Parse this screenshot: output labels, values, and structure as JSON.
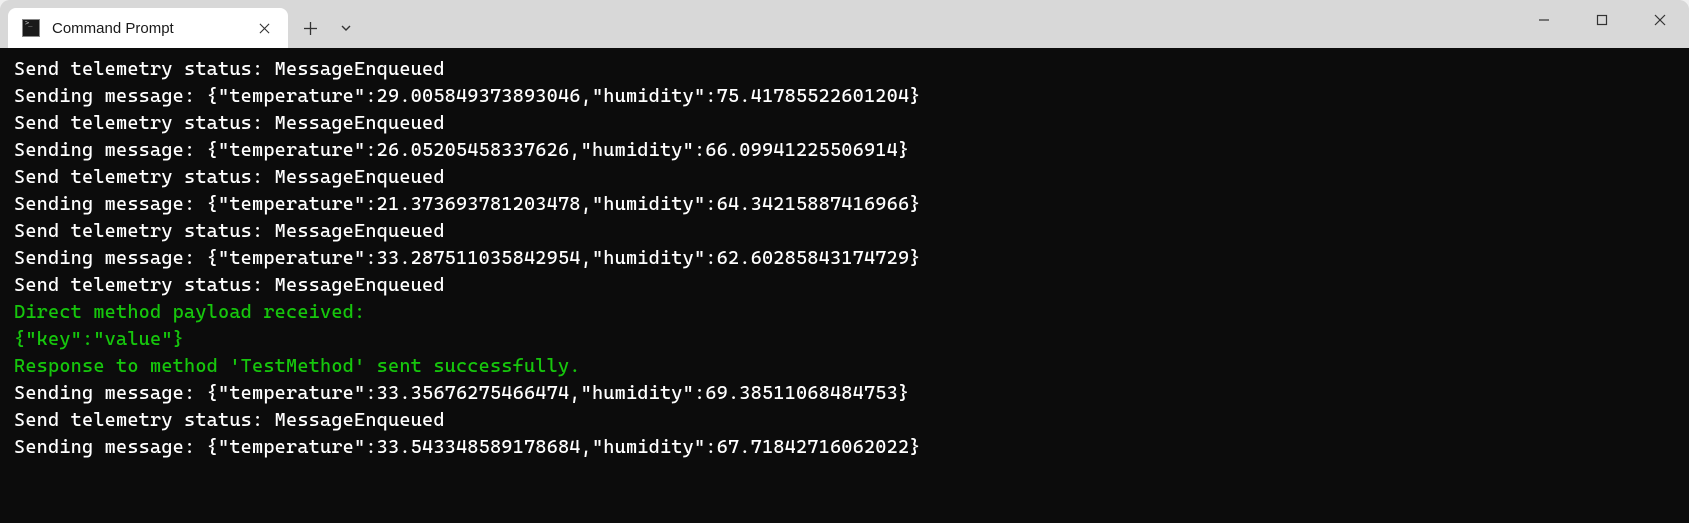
{
  "tab": {
    "title": "Command Prompt"
  },
  "terminal": {
    "lines": [
      {
        "text": "Send telemetry status: MessageEnqueued",
        "color": "white"
      },
      {
        "text": "Sending message: {\"temperature\":29.005849373893046,\"humidity\":75.41785522601204}",
        "color": "white"
      },
      {
        "text": "Send telemetry status: MessageEnqueued",
        "color": "white"
      },
      {
        "text": "Sending message: {\"temperature\":26.05205458337626,\"humidity\":66.09941225506914}",
        "color": "white"
      },
      {
        "text": "Send telemetry status: MessageEnqueued",
        "color": "white"
      },
      {
        "text": "Sending message: {\"temperature\":21.373693781203478,\"humidity\":64.34215887416966}",
        "color": "white"
      },
      {
        "text": "Send telemetry status: MessageEnqueued",
        "color": "white"
      },
      {
        "text": "Sending message: {\"temperature\":33.287511035842954,\"humidity\":62.60285843174729}",
        "color": "white"
      },
      {
        "text": "Send telemetry status: MessageEnqueued",
        "color": "white"
      },
      {
        "text": "Direct method payload received:",
        "color": "green"
      },
      {
        "text": "{\"key\":\"value\"}",
        "color": "green"
      },
      {
        "text": "Response to method 'TestMethod' sent successfully.",
        "color": "green"
      },
      {
        "text": "Sending message: {\"temperature\":33.35676275466474,\"humidity\":69.38511068484753}",
        "color": "white"
      },
      {
        "text": "Send telemetry status: MessageEnqueued",
        "color": "white"
      },
      {
        "text": "Sending message: {\"temperature\":33.543348589178684,\"humidity\":67.71842716062022}",
        "color": "white"
      }
    ]
  }
}
